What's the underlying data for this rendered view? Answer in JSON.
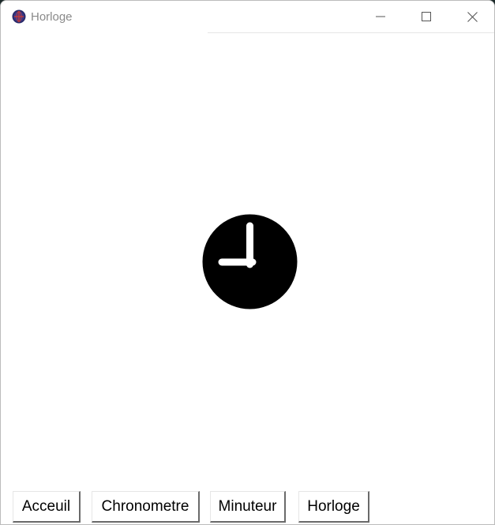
{
  "window": {
    "title": "Horloge",
    "icons": {
      "app": "globe-icon",
      "minimize": "minimize-icon",
      "maximize": "maximize-icon",
      "close": "close-icon"
    }
  },
  "main": {
    "icon": "clock-icon"
  },
  "buttons": {
    "acceuil": "Acceuil",
    "chronometre": "Chronometre",
    "minuteur": "Minuteur",
    "horloge": "Horloge"
  },
  "colors": {
    "clock_face": "#000000",
    "clock_hands": "#ffffff",
    "title_text": "#8a8a8a"
  }
}
